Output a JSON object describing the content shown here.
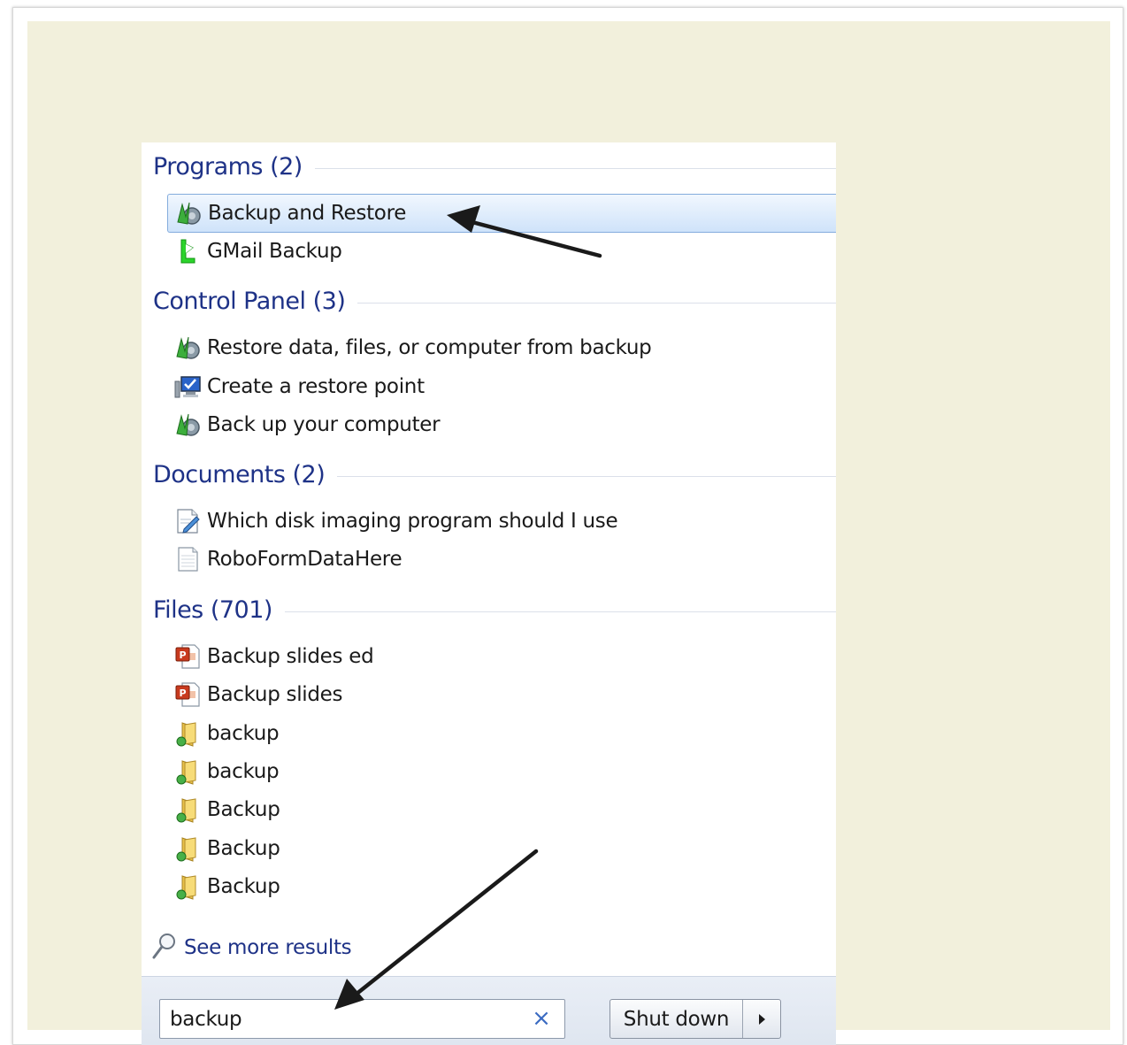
{
  "groups": [
    {
      "title": "Programs (2)",
      "items": [
        {
          "label": "Backup and Restore",
          "icon": "backup-restore-icon",
          "selected": true
        },
        {
          "label": "GMail Backup",
          "icon": "gmail-backup-icon"
        }
      ]
    },
    {
      "title": "Control Panel (3)",
      "items": [
        {
          "label": "Restore data, files, or computer from backup",
          "icon": "backup-restore-icon"
        },
        {
          "label": "Create a restore point",
          "icon": "system-monitor-icon"
        },
        {
          "label": "Back up your computer",
          "icon": "backup-restore-icon"
        }
      ]
    },
    {
      "title": "Documents (2)",
      "items": [
        {
          "label": "Which disk imaging program should I use",
          "icon": "document-edit-icon"
        },
        {
          "label": "RoboFormDataHere",
          "icon": "text-document-icon"
        }
      ]
    },
    {
      "title": "Files (701)",
      "items": [
        {
          "label": "Backup slides ed",
          "icon": "powerpoint-file-icon"
        },
        {
          "label": "Backup slides",
          "icon": "powerpoint-file-icon"
        },
        {
          "label": "backup",
          "icon": "folder-icon"
        },
        {
          "label": "backup",
          "icon": "folder-icon"
        },
        {
          "label": "Backup",
          "icon": "folder-icon"
        },
        {
          "label": "Backup",
          "icon": "folder-icon"
        },
        {
          "label": "Backup",
          "icon": "folder-icon"
        }
      ]
    }
  ],
  "see_more": {
    "label": "See more results",
    "icon": "search-magnifier-icon"
  },
  "search": {
    "value": "backup",
    "clear_icon": "clear-x-icon"
  },
  "shutdown": {
    "label": "Shut down",
    "arrow_icon": "chevron-right-icon"
  },
  "colors": {
    "group_title": "#1e3287",
    "link": "#1e3287",
    "background": "#f2f0dc",
    "arrow": "#1a1a1a"
  }
}
